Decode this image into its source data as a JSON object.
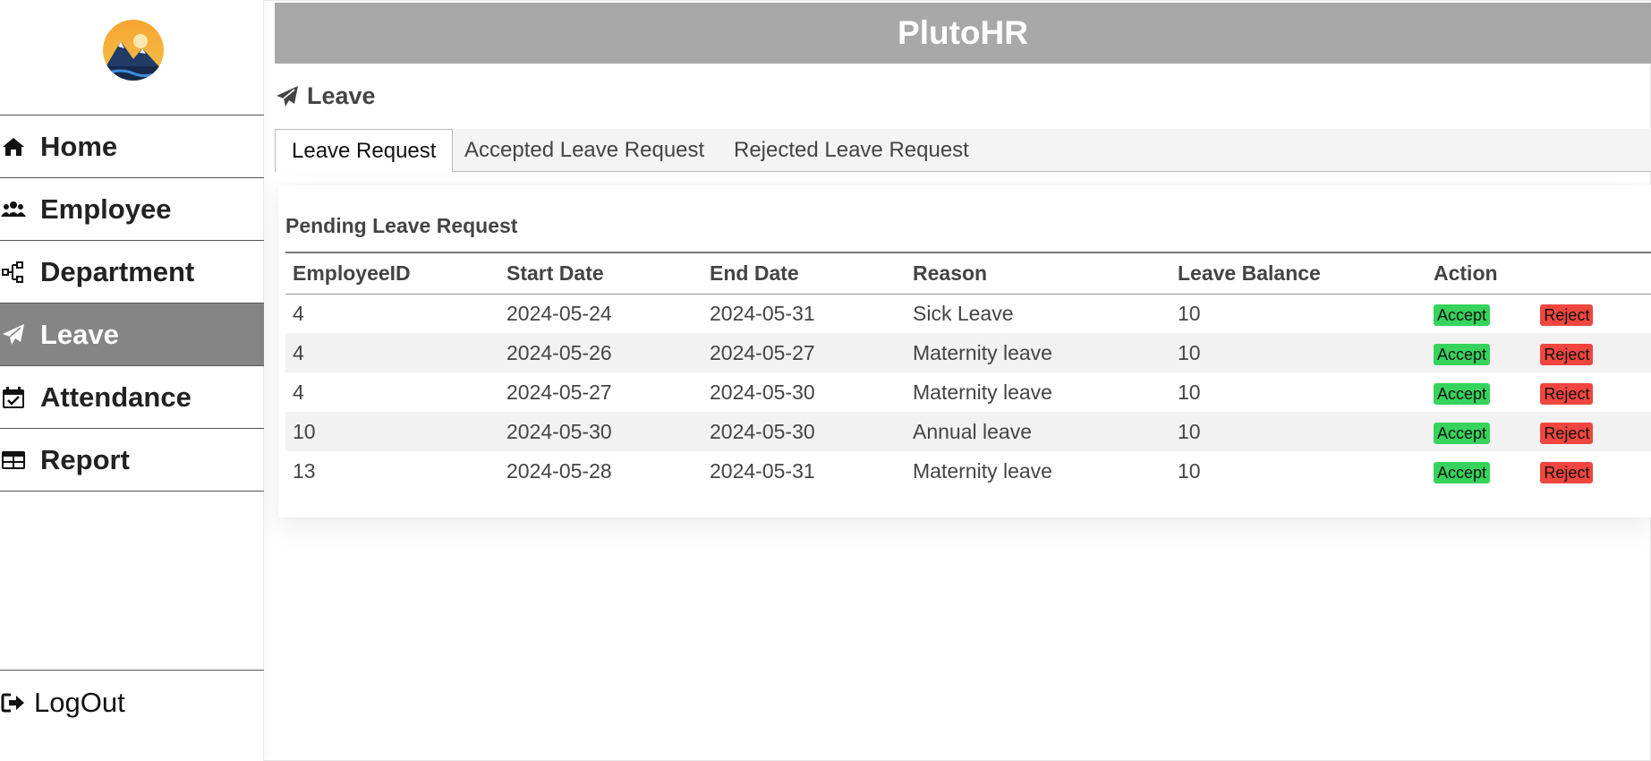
{
  "app": {
    "title": "PlutoHR"
  },
  "sidebar": {
    "items": [
      {
        "label": "Home",
        "icon": "home-icon",
        "active": false
      },
      {
        "label": "Employee",
        "icon": "users-icon",
        "active": false
      },
      {
        "label": "Department",
        "icon": "sitemap-icon",
        "active": false
      },
      {
        "label": "Leave",
        "icon": "paper-plane-icon",
        "active": true
      },
      {
        "label": "Attendance",
        "icon": "calendar-check-icon",
        "active": false
      },
      {
        "label": "Report",
        "icon": "table-icon",
        "active": false
      }
    ],
    "logout_label": "LogOut"
  },
  "page": {
    "title": "Leave"
  },
  "tabs": [
    {
      "label": "Leave Request",
      "active": true
    },
    {
      "label": "Accepted Leave Request",
      "active": false
    },
    {
      "label": "Rejected Leave Request",
      "active": false
    }
  ],
  "panel": {
    "title": "Pending Leave Request",
    "columns": [
      "EmployeeID",
      "Start Date",
      "End Date",
      "Reason",
      "Leave Balance",
      "Action"
    ],
    "rows": [
      {
        "employee_id": "4",
        "start": "2024-05-24",
        "end": "2024-05-31",
        "reason": "Sick Leave",
        "balance": "10"
      },
      {
        "employee_id": "4",
        "start": "2024-05-26",
        "end": "2024-05-27",
        "reason": "Maternity leave",
        "balance": "10"
      },
      {
        "employee_id": "4",
        "start": "2024-05-27",
        "end": "2024-05-30",
        "reason": "Maternity leave",
        "balance": "10"
      },
      {
        "employee_id": "10",
        "start": "2024-05-30",
        "end": "2024-05-30",
        "reason": "Annual leave",
        "balance": "10"
      },
      {
        "employee_id": "13",
        "start": "2024-05-28",
        "end": "2024-05-31",
        "reason": "Maternity leave",
        "balance": "10"
      }
    ],
    "accept_label": "Accept",
    "reject_label": "Reject"
  },
  "colors": {
    "header_bg": "#a9a8a9",
    "active_nav_bg": "#858585",
    "accept": "#36d35c",
    "reject": "#f0463f"
  }
}
